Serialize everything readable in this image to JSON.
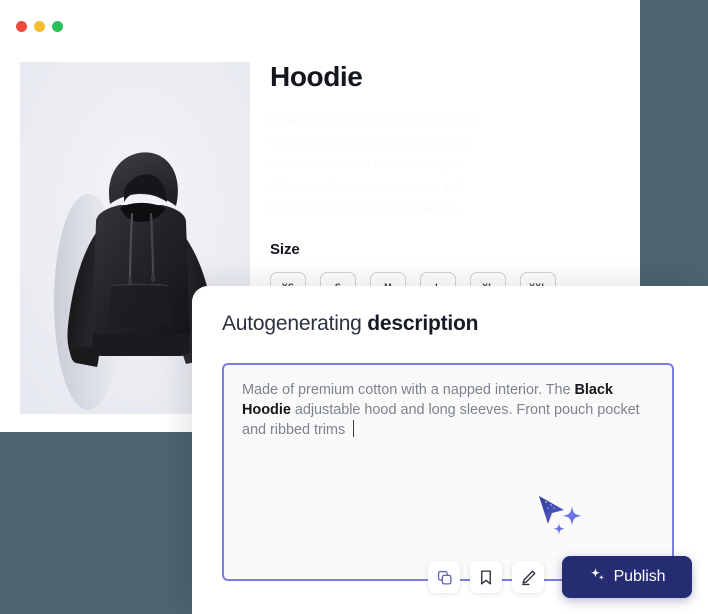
{
  "window": {
    "traffic_lights": [
      {
        "name": "close",
        "color": "#ef4b3c"
      },
      {
        "name": "minimize",
        "color": "#f6bb2e"
      },
      {
        "name": "maximize",
        "color": "#2cbe5a"
      }
    ]
  },
  "product": {
    "title": "Hoodie",
    "image_alt": "black-hoodie-photo",
    "image_bg": "#eef0f5",
    "placeholder_lines": [
      "Lorem ipsum dolor sit amet consectetur",
      "adipiscing elit sed do eiusmod tempor",
      "incididunt ut labore et dolore magna",
      "aliqua ut enim ad minim veniam quis",
      "nostrud exercitation ullamco laboris"
    ],
    "size": {
      "label": "Size",
      "options": [
        "XS",
        "S",
        "M",
        "L",
        "XL",
        "XXL"
      ]
    }
  },
  "generator": {
    "heading_regular": "Autogenerating",
    "heading_bold": "description",
    "editor": {
      "border_color": "#7a7de6",
      "background": "#fafafa",
      "text_segments": [
        {
          "text": "Made of premium cotton with a napped interior. The ",
          "bold": false
        },
        {
          "text": "Black Hoodie",
          "bold": true
        },
        {
          "text": " adjustable hood and long sleeves. Front pouch pocket and ribbed trims ",
          "bold": false
        }
      ],
      "full_text": "Made of premium cotton with a napped interior. The Black Hoodie adjustable hood and long sleeves. Front pouch pocket and ribbed trims",
      "caret_visible": true
    },
    "ai_cursor": {
      "name": "ai-sparkle-cursor",
      "color": "#4a4fb0",
      "sparkle_color": "#6d72e8"
    },
    "actions": {
      "icons": [
        {
          "name": "copy-icon",
          "label": "Copy",
          "color": "#6366b8"
        },
        {
          "name": "bookmark-icon",
          "label": "Save",
          "color": "#2b3039"
        },
        {
          "name": "edit-icon",
          "label": "Edit",
          "color": "#2b3039"
        }
      ],
      "publish": {
        "label": "Publish",
        "icon": "sparkle-icon",
        "background": "#252c72",
        "text_color": "#ffffff"
      }
    }
  },
  "theme": {
    "backdrop": "#4c656e",
    "card": "#ffffff",
    "accent_indigo": "#7a7de6",
    "accent_navy": "#252c72"
  }
}
